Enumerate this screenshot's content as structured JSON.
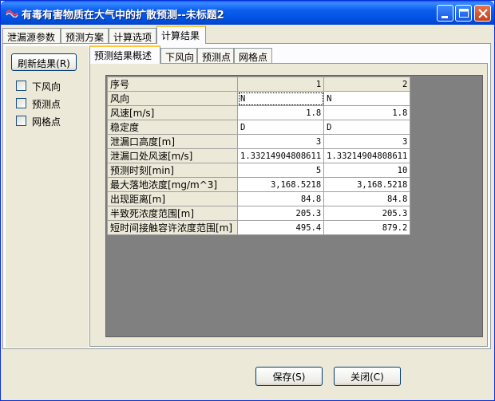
{
  "window": {
    "title": "有毒有害物质在大气中的扩散预测--未标题2"
  },
  "main_tabs": [
    {
      "label": "泄漏源参数",
      "active": false
    },
    {
      "label": "预测方案",
      "active": false
    },
    {
      "label": "计算选项",
      "active": false
    },
    {
      "label": "计算结果",
      "active": true
    }
  ],
  "left_panel": {
    "refresh_button": "刷新结果(R)",
    "checkboxes": [
      {
        "label": "下风向",
        "checked": false
      },
      {
        "label": "预测点",
        "checked": false
      },
      {
        "label": "网格点",
        "checked": false
      }
    ]
  },
  "result_tabs": [
    {
      "label": "预测结果概述",
      "active": true
    },
    {
      "label": "下风向",
      "active": false
    },
    {
      "label": "预测点",
      "active": false
    },
    {
      "label": "网格点",
      "active": false
    }
  ],
  "grid": {
    "header": {
      "label": "序号",
      "col1": "1",
      "col2": "2"
    },
    "rows": [
      {
        "label": "风向",
        "v1": "N",
        "v2": "N",
        "align": "left"
      },
      {
        "label": "风速[m/s]",
        "v1": "1.8",
        "v2": "1.8",
        "align": "right"
      },
      {
        "label": "稳定度",
        "v1": "D",
        "v2": "D",
        "align": "left"
      },
      {
        "label": "泄漏口高度[m]",
        "v1": "3",
        "v2": "3",
        "align": "right"
      },
      {
        "label": "泄漏口处风速[m/s]",
        "v1": "1.33214904808611",
        "v2": "1.33214904808611",
        "align": "right"
      },
      {
        "label": "预测时刻[min]",
        "v1": "5",
        "v2": "10",
        "align": "right"
      },
      {
        "label": "最大落地浓度[mg/m^3]",
        "v1": "3,168.5218",
        "v2": "3,168.5218",
        "align": "right"
      },
      {
        "label": "出现距离[m]",
        "v1": "84.8",
        "v2": "84.8",
        "align": "right"
      },
      {
        "label": "半致死浓度范围[m]",
        "v1": "205.3",
        "v2": "205.3",
        "align": "right"
      },
      {
        "label": "短时间接触容许浓度范围[m]",
        "v1": "495.4",
        "v2": "879.2",
        "align": "right"
      }
    ]
  },
  "footer": {
    "save_button": "保存(S)",
    "close_button": "关闭(C)"
  }
}
